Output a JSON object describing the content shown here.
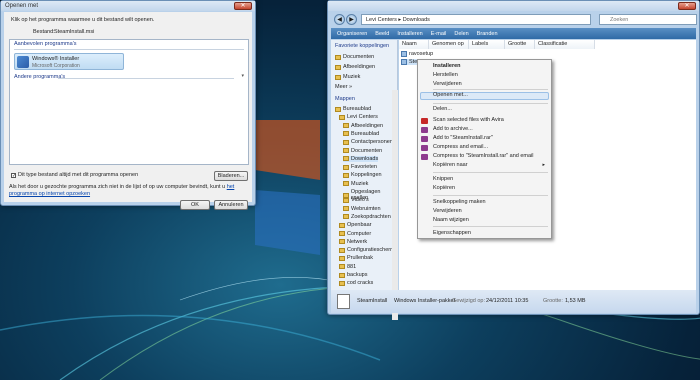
{
  "openwith": {
    "title": "Openen met",
    "intro": "Klik op het programma waarmee u dit bestand wilt openen.",
    "file_label": "Bestand:",
    "file_name": "SteamInstall.msi",
    "recommended_header": "Aanbevolen programma's",
    "program_name": "Windows® Installer",
    "program_publisher": "Microsoft Corporation",
    "other_header": "Andere programma's",
    "always_checkbox": "Dit type bestand altijd met dit programma openen",
    "browse_button": "Bladeren...",
    "note": "Als het door u gezochte programma zich niet in de lijst of op uw computer bevindt, kunt u",
    "note_link": "het programma op internet opzoeken",
    "ok_button": "OK",
    "cancel_button": "Annuleren"
  },
  "explorer": {
    "breadcrumb": "Levi Centers ▸ Downloads",
    "search_placeholder": "Zoeken",
    "toolbar": [
      "Organiseren",
      "Beeld",
      "Installeren",
      "E-mail",
      "Delen",
      "Branden"
    ],
    "favorites_header": "Favoriete koppelingen",
    "favorites": [
      "Documenten",
      "Afbeeldingen",
      "Muziek",
      "Meer »"
    ],
    "folders_header": "Mappen",
    "folders": [
      "Bureaublad",
      "Levi Centers",
      "Afbeeldingen",
      "Bureaublad",
      "Contactpersonen",
      "Documenten",
      "Downloads",
      "Favorieten",
      "Koppelingen",
      "Muziek",
      "Opgeslagen spellen",
      "Video's",
      "Webruimten",
      "Zoekopdrachten",
      "Openbaar",
      "Computer",
      "Netwerk",
      "Configuratiescherm",
      "Prullenbak",
      "881",
      "backups",
      "cod cracks"
    ],
    "columns": [
      "Naam",
      "Genomen op",
      "Labels",
      "Grootte",
      "Classificatie"
    ],
    "files": [
      "ravosetup",
      "Stea"
    ],
    "status": {
      "name": "SteamInstall",
      "type": "Windows Installer-pakket",
      "date_label": "Gewijzigd op:",
      "date": "24/12/2011 10:35",
      "size_label": "Grootte:",
      "size": "1,53 MB"
    }
  },
  "context_menu": {
    "items": [
      "Installeren",
      "Herstellen",
      "Verwijderen",
      "Openen met...",
      "Delen...",
      "Scan selected files with Avira",
      "Add to archive...",
      "Add to \"SteamInstall.rar\"",
      "Compress and email...",
      "Compress to \"SteamInstall.rar\" and email",
      "Kopiëren naar",
      "Knippen",
      "Kopiëren",
      "Snelkoppeling maken",
      "Verwijderen",
      "Naam wijzigen",
      "Eigenschappen"
    ]
  },
  "colors": {
    "desktop": "#0d3f5e",
    "selection": "#dce9f7",
    "link": "#0645ad"
  }
}
